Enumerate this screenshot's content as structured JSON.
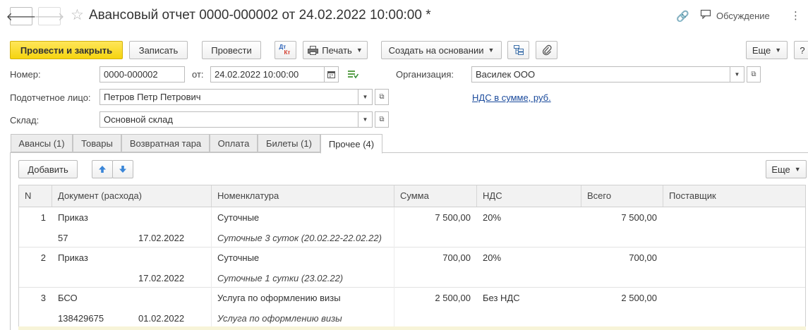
{
  "window": {
    "title": "Авансовый отчет 0000-000002 от 24.02.2022 10:00:00 *",
    "discussion_label": "Обсуждение",
    "more_glyph": "⋮",
    "back_glyph": "🡐",
    "forward_glyph": "🡒",
    "star_glyph": "☆",
    "link_glyph": "🔗"
  },
  "toolbar": {
    "post_close": "Провести и закрыть",
    "save": "Записать",
    "post": "Провести",
    "dtkt_top": "Дт",
    "dtkt_bottom": "Кт",
    "print": "Печать",
    "create_based": "Создать на основании",
    "more": "Еще",
    "help": "?"
  },
  "form": {
    "number_label": "Номер:",
    "number_value": "0000-000002",
    "date_label": "от:",
    "date_value": "24.02.2022 10:00:00",
    "org_label": "Организация:",
    "org_value": "Василек ООО",
    "person_label": "Подотчетное лицо:",
    "person_value": "Петров Петр Петрович",
    "vat_link": "НДС в сумме, руб.",
    "warehouse_label": "Склад:",
    "warehouse_value": "Основной склад"
  },
  "tabs": [
    {
      "label": "Авансы (1)"
    },
    {
      "label": "Товары"
    },
    {
      "label": "Возвратная тара"
    },
    {
      "label": "Оплата"
    },
    {
      "label": "Билеты (1)"
    },
    {
      "label": "Прочее (4)"
    }
  ],
  "active_tab": 5,
  "table_toolbar": {
    "add": "Добавить",
    "more": "Еще"
  },
  "table": {
    "columns": [
      "N",
      "Документ (расхода)",
      "Номенклатура",
      "Сумма",
      "НДС",
      "Всего",
      "Поставщик"
    ],
    "rows": [
      {
        "n": "1",
        "doc": "Приказ",
        "doc_num": "57",
        "doc_date": "17.02.2022",
        "item": "Суточные",
        "item_desc": "Суточные 3 суток (20.02.22-22.02.22)",
        "sum": "7 500,00",
        "vat": "20%",
        "total": "7 500,00",
        "supplier": ""
      },
      {
        "n": "2",
        "doc": "Приказ",
        "doc_num": "",
        "doc_date": "17.02.2022",
        "item": "Суточные",
        "item_desc": "Суточные 1 сутки (23.02.22)",
        "sum": "700,00",
        "vat": "20%",
        "total": "700,00",
        "supplier": ""
      },
      {
        "n": "3",
        "doc": "БСО",
        "doc_num": "138429675",
        "doc_date": "01.02.2022",
        "item": "Услуга по оформлению визы",
        "item_desc": "Услуга по оформлению визы",
        "sum": "2 500,00",
        "vat": "Без НДС",
        "total": "2 500,00",
        "supplier": ""
      }
    ]
  },
  "colors": {
    "primary_button": "#f5d40f",
    "link": "#1a4a9c",
    "arrow_blue": "#3a86d8"
  }
}
